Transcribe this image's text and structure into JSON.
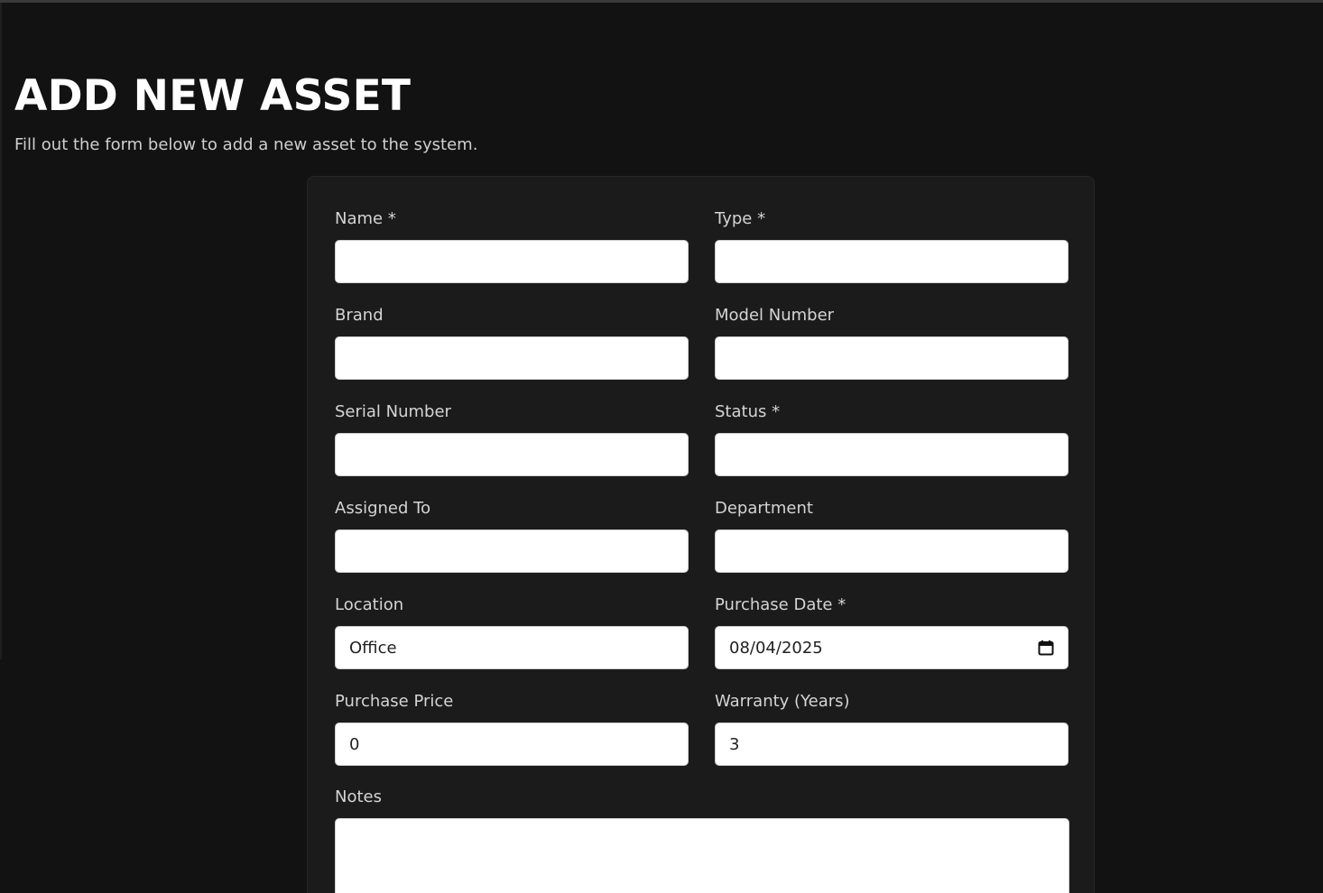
{
  "header": {
    "title": "ADD NEW ASSET",
    "subtitle": "Fill out the form below to add a new asset to the system."
  },
  "form": {
    "fields": [
      {
        "label": "Name *",
        "value": ""
      },
      {
        "label": "Type *",
        "value": ""
      },
      {
        "label": "Brand",
        "value": ""
      },
      {
        "label": "Model Number",
        "value": ""
      },
      {
        "label": "Serial Number",
        "value": ""
      },
      {
        "label": "Status *",
        "value": ""
      },
      {
        "label": "Assigned To",
        "value": ""
      },
      {
        "label": "Department",
        "value": ""
      },
      {
        "label": "Location",
        "value": "Office"
      },
      {
        "label": "Purchase Date *",
        "value": "08/04/2025",
        "icon": "calendar-icon"
      },
      {
        "label": "Purchase Price",
        "value": "0"
      },
      {
        "label": "Warranty (Years)",
        "value": "3"
      }
    ],
    "notes": {
      "label": "Notes",
      "value": ""
    }
  },
  "colors": {
    "background": "#121212",
    "card": "#1b1b1b",
    "input": "#ffffff",
    "label": "#d4d4d4"
  }
}
